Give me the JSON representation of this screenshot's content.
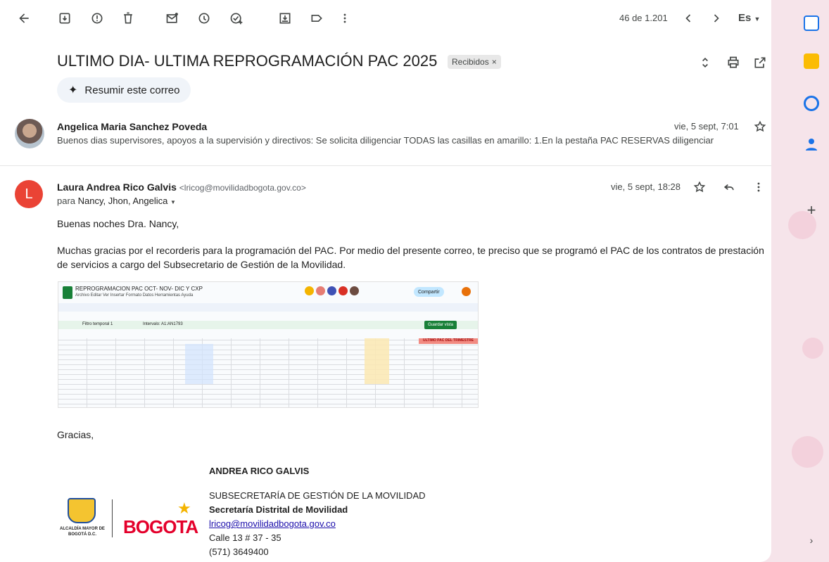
{
  "toolbar": {
    "pager": "46 de 1.201",
    "language": "Es"
  },
  "subject": {
    "title": "ULTIMO DIA- ULTIMA REPROGRAMACIÓN PAC 2025",
    "label": "Recibidos",
    "label_close": "×"
  },
  "summarize": {
    "label": "Resumir este correo"
  },
  "message1": {
    "sender": "Angelica Maria Sanchez Poveda",
    "date": "vie, 5 sept, 7:01",
    "snippet": "Buenos dias supervisores, apoyos a la supervisión y directivos: Se solicita diligenciar TODAS las casillas en amarillo: 1.En la pestaña PAC RESERVAS diligenciar"
  },
  "message2": {
    "avatar_letter": "L",
    "sender": "Laura Andrea Rico Galvis",
    "email": "<lricog@movilidadbogota.gov.co>",
    "date": "vie, 5 sept, 18:28",
    "to_prefix": "para",
    "recipients": "Nancy, Jhon, Angelica",
    "greeting": "Buenas noches Dra. Nancy,",
    "paragraph": "Muchas gracias por el recorderis para la programación del PAC. Por medio del presente correo, te preciso que se programó el PAC de los contratos de prestación de servicios a cargo del Subsecretario de Gestión de la Movilidad.",
    "closing": "Gracias,"
  },
  "sheet": {
    "title": "REPROGRAMACION PAC OCT- NOV- DIC Y CXP",
    "menu": "Archivo  Editar  Ver  Insertar  Formato  Datos  Herramientas  Ayuda",
    "share": "Compartir",
    "filter": "Filtro temporal 1",
    "interval": "Intervalo: A1:AN1793",
    "save_view": "Guardar vista",
    "header_red": "ULTIMO PAC DEL TRIMESTRE"
  },
  "signature": {
    "name": "ANDREA RICO GALVIS",
    "dept": "SUBSECRETARÍA DE GESTIÓN DE LA MOVILIDAD",
    "secretaria": "Secretaría Distrital de Movilidad",
    "email": "lricog@movilidadbogota.gov.co",
    "address": "Calle 13 # 37 - 35",
    "phone": "(571) 3649400",
    "logo_text": "ALCALDÍA MAYOR DE BOGOTÁ D.C.",
    "bogota": "BOGOTA"
  },
  "colors": {
    "avatar_red": "#ea4335",
    "link": "#1a0dab",
    "sheet_green": "#188038"
  }
}
